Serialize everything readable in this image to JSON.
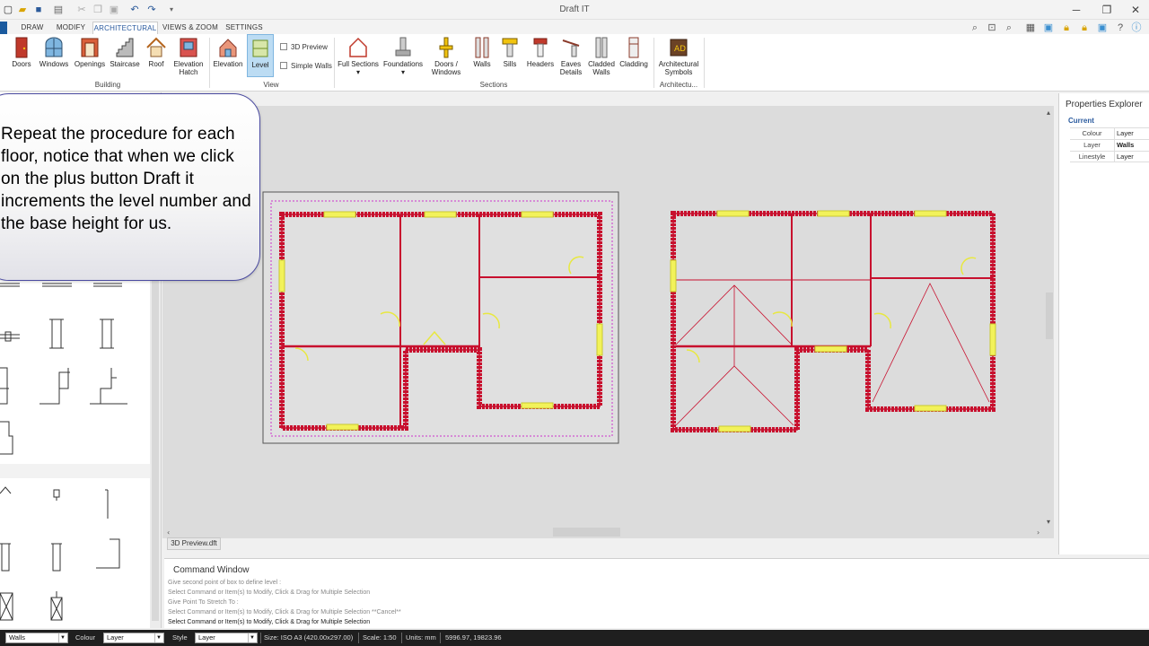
{
  "app": {
    "title": "Draft IT"
  },
  "tabs": [
    "DRAW",
    "MODIFY",
    "ARCHITECTURAL",
    "VIEWS & ZOOM",
    "SETTINGS"
  ],
  "active_tab": "ARCHITECTURAL",
  "ribbon": {
    "building": {
      "label": "Building",
      "buttons": [
        "Doors",
        "Windows",
        "Openings",
        "Staircase",
        "Roof",
        "Elevation\nHatch"
      ]
    },
    "view": {
      "label": "View",
      "buttons": [
        "Elevation",
        "Level"
      ],
      "checkboxes": [
        "3D Preview",
        "Simple Walls"
      ]
    },
    "sections": {
      "label": "Sections",
      "buttons": [
        "Full Sections",
        "Foundations",
        "Doors /\nWindows",
        "Walls",
        "Sills",
        "Headers",
        "Eaves\nDetails",
        "Cladded\nWalls",
        "Cladding"
      ]
    },
    "architectural": {
      "label": "Architectu...",
      "buttons": [
        "Architectural\nSymbols"
      ]
    }
  },
  "callout": {
    "text": "Repeat the procedure for each floor, notice that when we click on the plus button Draft it increments the level number and the base height for us."
  },
  "doc_tab": "3D Preview.dft",
  "command_window": {
    "title": "Command Window",
    "lines": [
      "Give second point of box to define level :",
      "Select Command or Item(s) to Modify, Click & Drag for Multiple Selection",
      "Give Point To Stretch To :",
      "Select Command or Item(s) to Modify, Click & Drag for Multiple Selection  **Cancel**",
      "Select Command or Item(s) to Modify, Click & Drag for Multiple Selection"
    ]
  },
  "properties": {
    "title": "Properties Explorer",
    "section": "Current",
    "rows": [
      {
        "key": "Colour",
        "value": "Layer"
      },
      {
        "key": "Layer",
        "value": "Walls"
      },
      {
        "key": "Linestyle",
        "value": "Layer"
      }
    ]
  },
  "status_bar": {
    "layer_select": "Walls",
    "colour_label": "Colour",
    "colour_select": "Layer",
    "style_label": "Style",
    "style_select": "Layer",
    "size": "Size: ISO A3 (420.00x297.00)",
    "scale": "Scale: 1:50",
    "units": "Units: mm",
    "coords": "5996.97, 19823.96"
  },
  "colors": {
    "wall": "#c8102e",
    "opening": "#f2f25a",
    "selection": "#cc33cc",
    "accent": "#2a5a9e"
  }
}
